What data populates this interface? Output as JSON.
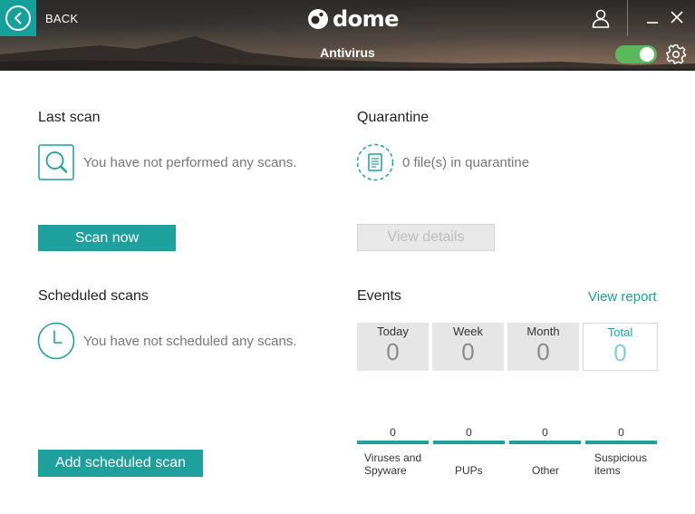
{
  "header": {
    "back_label": "BACK",
    "logo_text": "dome",
    "section_title": "Antivirus",
    "protection_enabled": true
  },
  "colors": {
    "accent": "#1ea19c",
    "toggle_on": "#5cb85c",
    "muted_text": "#777777"
  },
  "last_scan": {
    "title": "Last scan",
    "message": "You have not performed any scans.",
    "icon": "magnifier-icon",
    "button_label": "Scan now"
  },
  "quarantine": {
    "title": "Quarantine",
    "message": "0 file(s) in quarantine",
    "icon": "document-icon",
    "button_label": "View details"
  },
  "scheduled": {
    "title": "Scheduled scans",
    "message": "You have not scheduled any scans.",
    "icon": "clock-icon",
    "button_label": "Add scheduled scan"
  },
  "events": {
    "title": "Events",
    "report_link": "View report",
    "periods": [
      {
        "label": "Today",
        "value": "0"
      },
      {
        "label": "Week",
        "value": "0"
      },
      {
        "label": "Month",
        "value": "0"
      },
      {
        "label": "Total",
        "value": "0",
        "selected": true
      }
    ],
    "categories": [
      {
        "count": "0",
        "label_line1": "Viruses and",
        "label_line2": "Spyware"
      },
      {
        "count": "0",
        "label_line1": "",
        "label_line2": "PUPs"
      },
      {
        "count": "0",
        "label_line1": "",
        "label_line2": "Other"
      },
      {
        "count": "0",
        "label_line1": "Suspicious",
        "label_line2": "items"
      }
    ]
  }
}
